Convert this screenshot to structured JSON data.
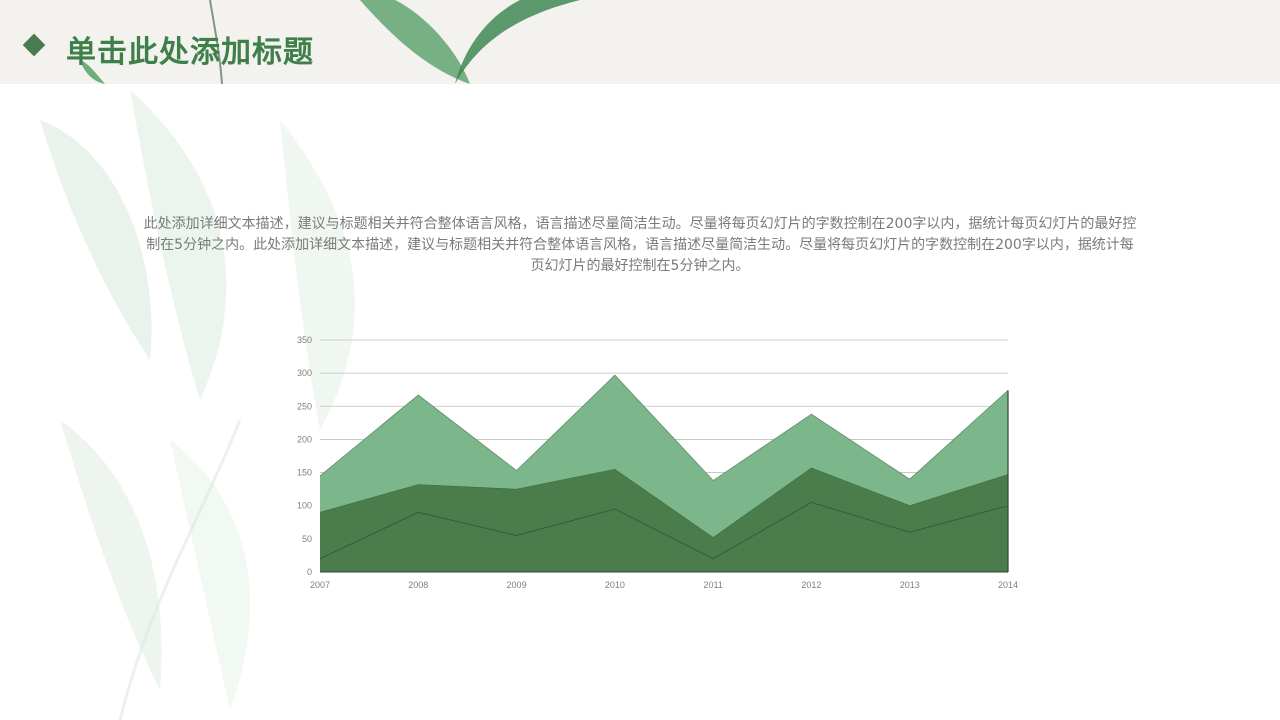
{
  "slide": {
    "title": "单击此处添加标题",
    "description": "此处添加详细文本描述，建议与标题相关并符合整体语言风格，语言描述尽量简洁生动。尽量将每页幻灯片的字数控制在200字以内，据统计每页幻灯片的最好控制在5分钟之内。此处添加详细文本描述，建议与标题相关并符合整体语言风格，语言描述尽量简洁生动。尽量将每页幻灯片的字数控制在200字以内，据统计每页幻灯片的最好控制在5分钟之内。"
  },
  "colors": {
    "title": "#3f7f4a",
    "diamond": "#4a7a4f",
    "series_top": "#7bb78b",
    "series_mid": "#4a7c4c",
    "grid": "#bfbfbf"
  },
  "chart_data": {
    "type": "area",
    "stacked": true,
    "x": [
      "2007",
      "2008",
      "2009",
      "2010",
      "2011",
      "2012",
      "2013",
      "2014"
    ],
    "series": [
      {
        "values": [
          20,
          90,
          55,
          95,
          20,
          105,
          60,
          100
        ]
      },
      {
        "values": [
          90,
          132,
          125,
          155,
          52,
          157,
          100,
          147
        ]
      },
      {
        "values": [
          145,
          267,
          153,
          297,
          138,
          238,
          140,
          274
        ]
      }
    ],
    "ylim": [
      0,
      350
    ],
    "yticks": [
      0,
      50,
      100,
      150,
      200,
      250,
      300,
      350
    ],
    "grid": true,
    "legend": "none"
  }
}
